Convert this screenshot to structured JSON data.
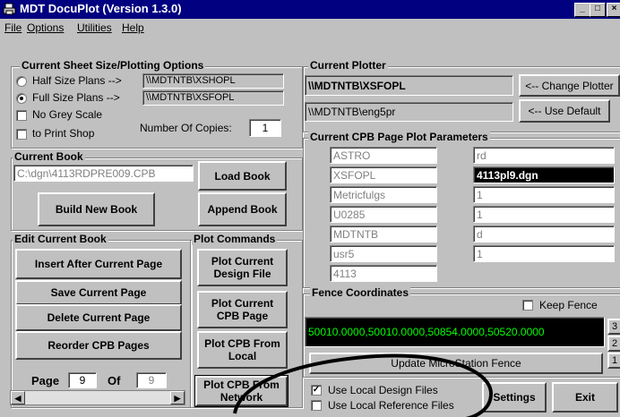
{
  "window": {
    "title": "MDT DocuPlot (Version 1.3.0)"
  },
  "menu": [
    "File",
    "Options",
    "Utilities",
    "Help"
  ],
  "sheet_options": {
    "title": "Current Sheet Size/Plotting Options",
    "half_label": "Half Size Plans -->",
    "half_value": "\\\\MDTNTB\\XSHOPL",
    "full_label": "Full Size Plans -->",
    "full_value": "\\\\MDTNTB\\XSFOPL",
    "full_selected": true,
    "no_grey_label": "No Grey Scale",
    "print_shop_label": "to Print Shop",
    "copies_label": "Number Of Copies:",
    "copies_value": "1"
  },
  "current_book": {
    "title": "Current Book",
    "path": "C:\\dgn\\4113RDPRE009.CPB",
    "load_label": "Load Book",
    "build_label": "Build New Book",
    "append_label": "Append Book"
  },
  "edit_book": {
    "title": "Edit Current Book",
    "insert_label": "Insert After Current Page",
    "save_label": "Save Current Page",
    "delete_label": "Delete Current Page",
    "reorder_label": "Reorder CPB Pages",
    "page_label": "Page",
    "page_value": "9",
    "of_label": "Of",
    "of_value": "9"
  },
  "plot_commands": {
    "title": "Plot Commands",
    "design_label": "Plot Current Design File",
    "cpb_label": "Plot Current CPB Page",
    "local_label": "Plot CPB From Local",
    "network_label": "Plot CPB From Network"
  },
  "current_plotter": {
    "title": "Current Plotter",
    "plotter": "\\\\MDTNTB\\XSFOPL",
    "change_label": "<-- Change Plotter",
    "default_path": "\\\\MDTNTB\\eng5pr",
    "default_label": "<-- Use Default"
  },
  "cpb_params": {
    "title": "Current CPB Page Plot Parameters",
    "left": [
      "ASTRO",
      "XSFOPL",
      "Metricfulgs",
      "U0285",
      "MDTNTB",
      "usr5",
      "4113"
    ],
    "right": [
      "rd",
      "4113pl9.dgn",
      "1",
      "1",
      "d",
      "1"
    ]
  },
  "fence": {
    "title": "Fence Coordinates",
    "keep_label": "Keep Fence",
    "coords": "50010.0000,50010.0000,50854.0000,50520.0000",
    "update_label": "Update MicroStation Fence",
    "side_numbers": [
      "3",
      "2",
      "1"
    ]
  },
  "bottom": {
    "local_design_label": "Use Local Design Files",
    "local_design_checked": true,
    "local_ref_label": "Use Local Reference Files",
    "settings_label": "Settings",
    "exit_label": "Exit"
  }
}
